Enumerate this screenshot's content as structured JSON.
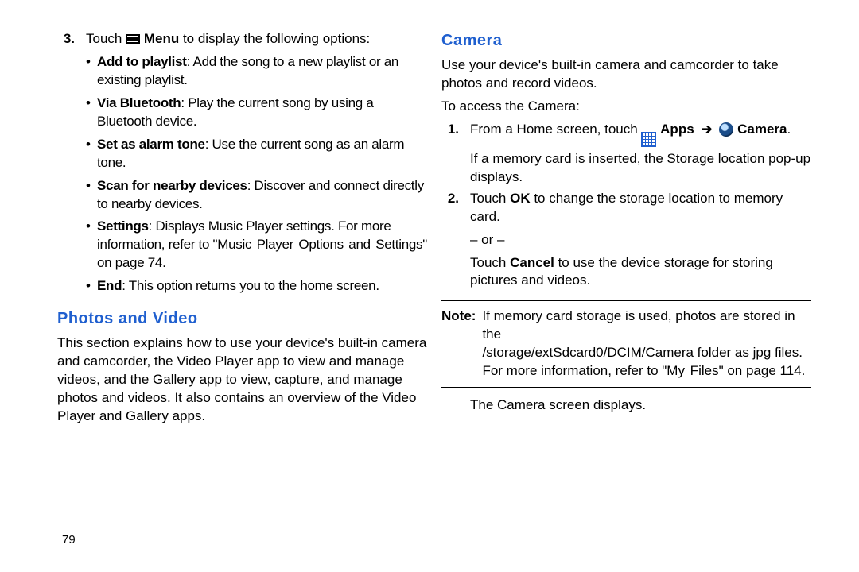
{
  "page_number": "79",
  "left": {
    "step_num": "3.",
    "step_text_pre": "Touch ",
    "step_text_post": " to display the following options:",
    "menu_label": "Menu",
    "bullets": [
      {
        "term": "Add to playlist",
        "desc": ": Add the song to a new playlist or an existing playlist."
      },
      {
        "term": "Via Bluetooth",
        "desc": ": Play the current song by using a Bluetooth device."
      },
      {
        "term": "Set as alarm tone",
        "desc": ": Use the current song as an alarm tone."
      },
      {
        "term": "Scan for nearby devices",
        "desc": ": Discover and connect directly to nearby devices."
      },
      {
        "term": "Settings",
        "desc_pre": ": Displays Music Player settings. For more information, refer to ",
        "xref": "\"Music Player Options and Settings\"",
        "desc_post": " on page 74."
      },
      {
        "term": "End",
        "desc": ": This option returns you to the home screen."
      }
    ],
    "section_title": "Photos and Video",
    "section_body": "This section explains how to use your device's built-in camera and camcorder, the Video Player app to view and manage videos, and the Gallery app to view, capture, and manage photos and videos. It also contains an overview of the Video Player and Gallery apps."
  },
  "right": {
    "section_title": "Camera",
    "intro": "Use your device's built-in camera and camcorder to take photos and record videos.",
    "access_line": "To access the Camera:",
    "step1_num": "1.",
    "step1_pre": "From a Home screen, touch ",
    "apps_label": "Apps",
    "arrow": "➔",
    "camera_label": "Camera",
    "step1_post": ".",
    "step1_body": "If a memory card is inserted, the Storage location pop-up displays.",
    "step2_num": "2.",
    "step2_pre": "Touch ",
    "ok_label": "OK",
    "step2_post": " to change the storage location to memory card.",
    "or_line": "– or –",
    "cancel_pre": "Touch ",
    "cancel_label": "Cancel",
    "cancel_post": " to use the device storage for storing pictures and videos.",
    "note_label": "Note:",
    "note_line1": "If memory card storage is used, photos are stored in the",
    "note_line2": "/storage/extSdcard0/DCIM/Camera folder as jpg files.",
    "note_line3_pre": "For more information, refer to ",
    "note_xref": "\"My Files\"",
    "note_line3_post": " on page 114.",
    "after_note": "The Camera screen displays."
  }
}
